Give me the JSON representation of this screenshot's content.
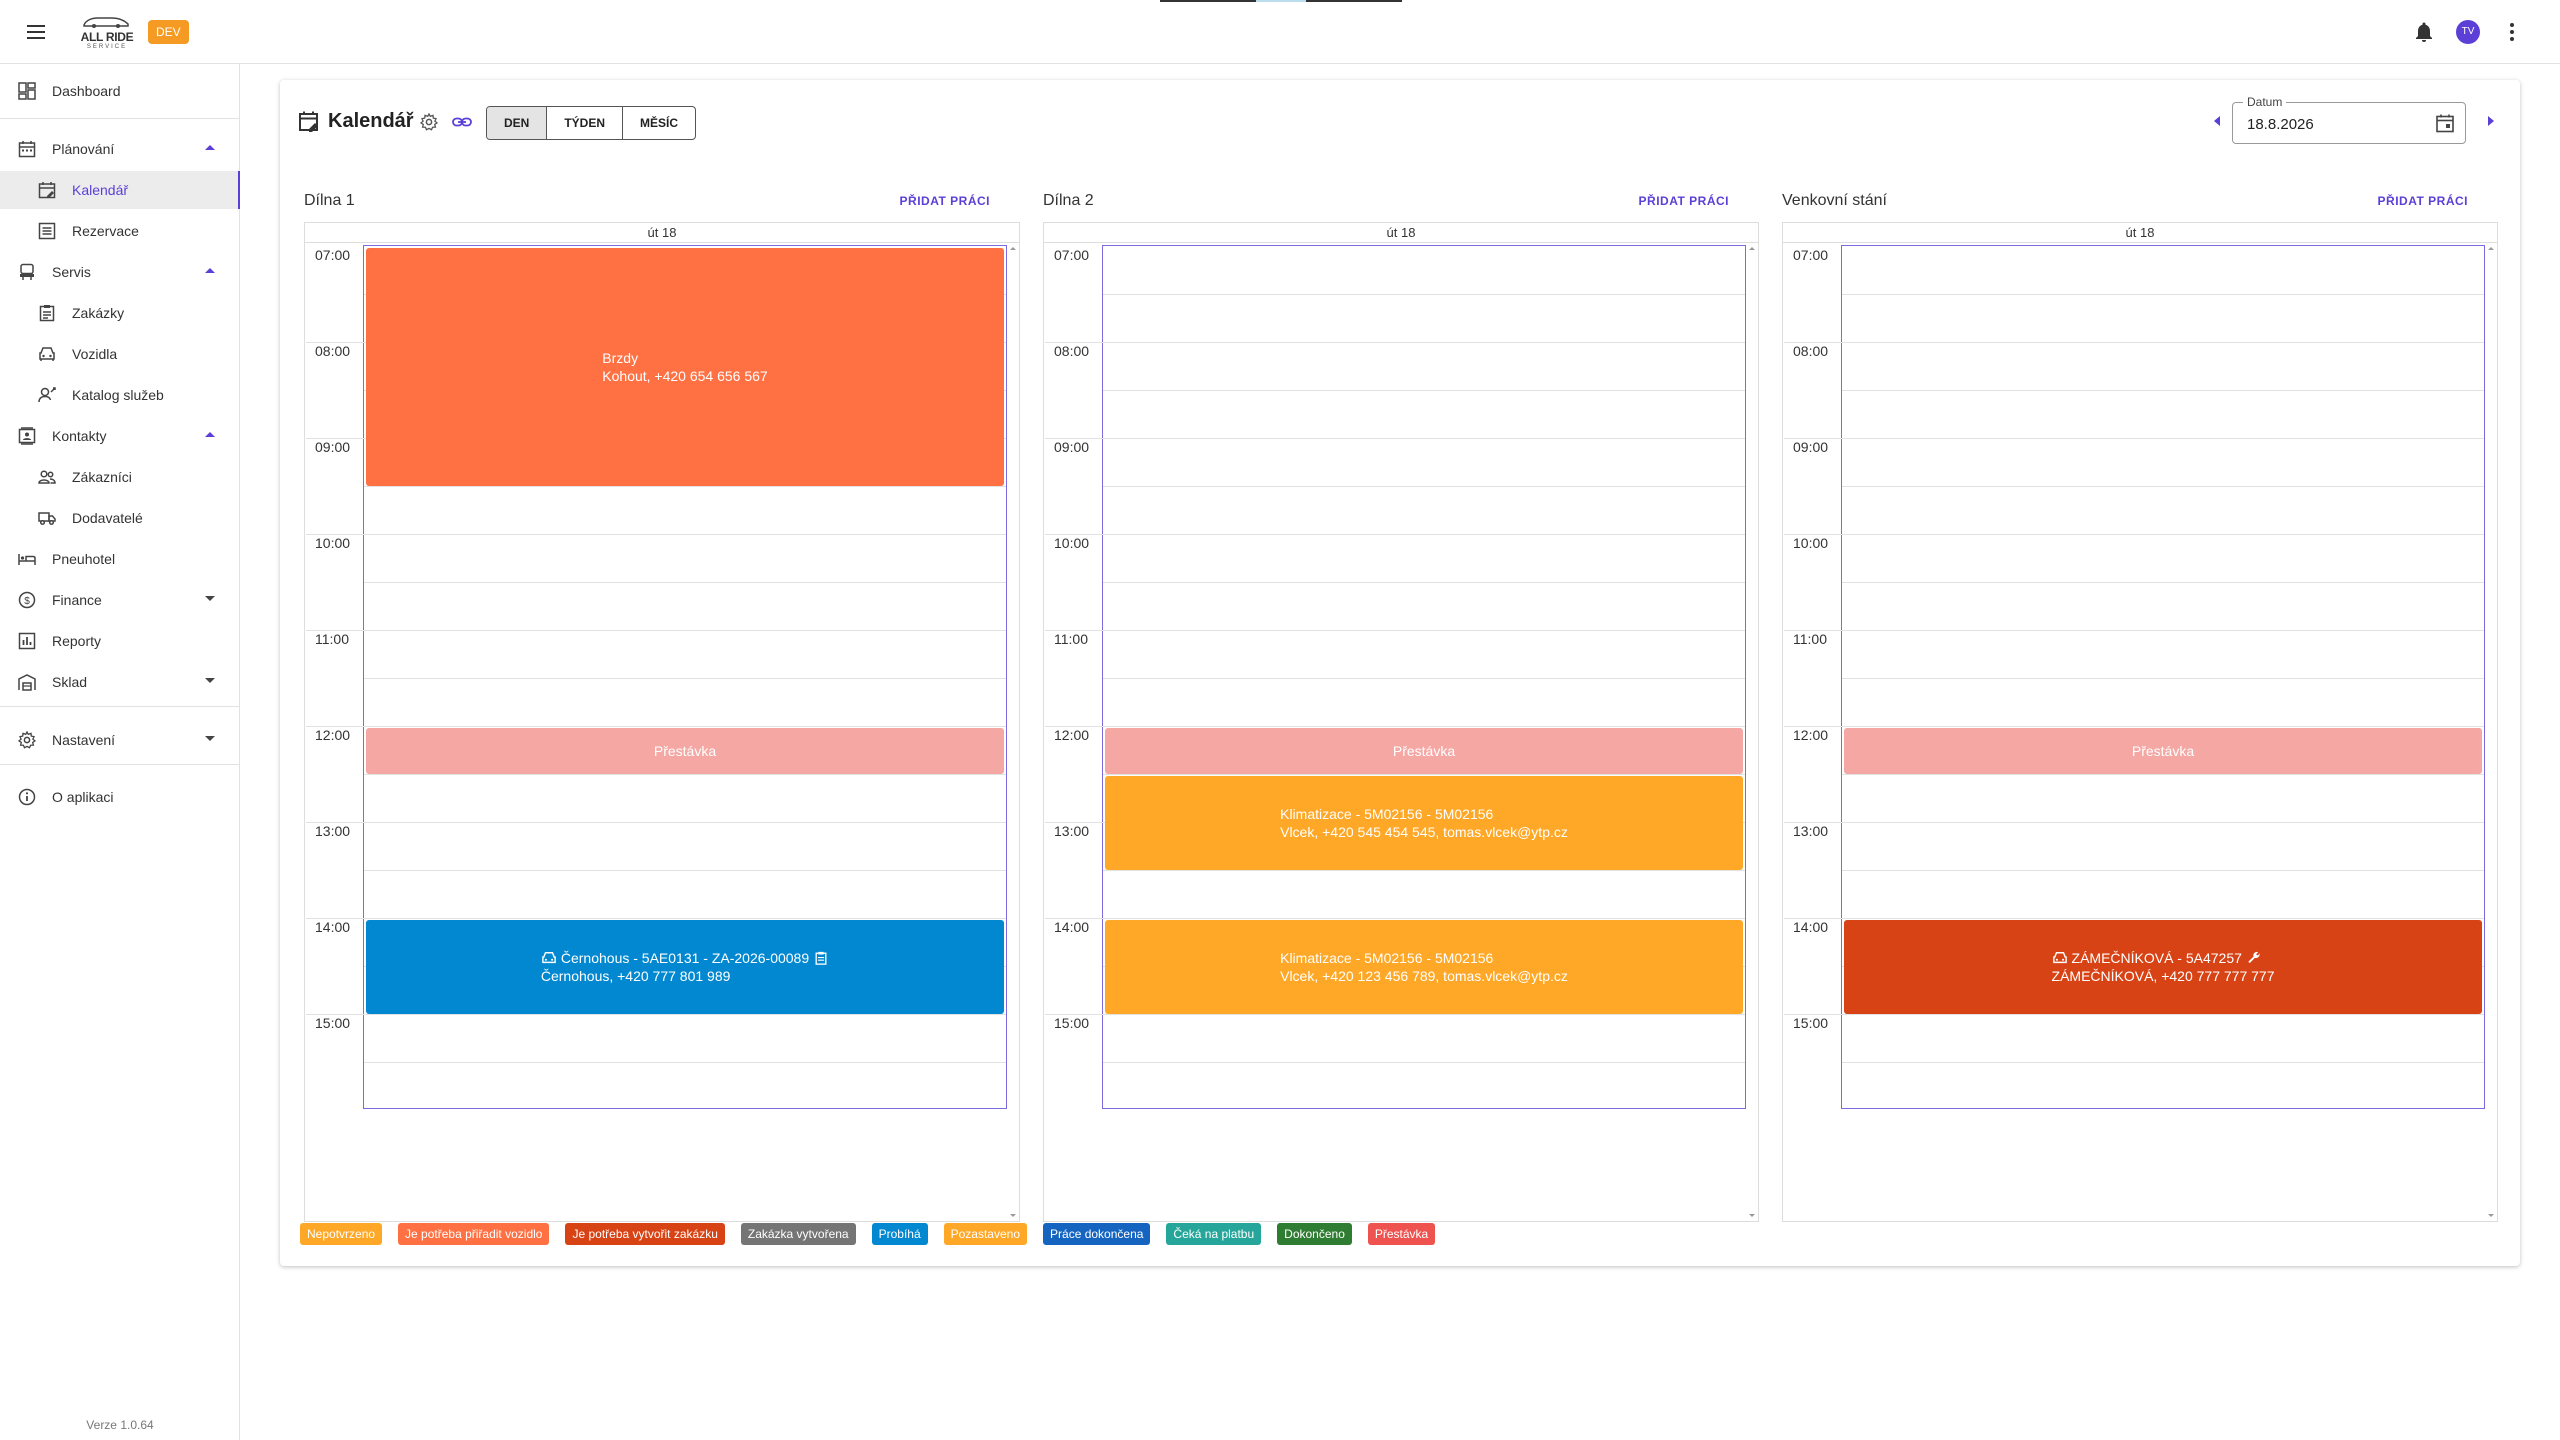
{
  "topbar": {
    "logo_text": "ALL RIDE",
    "logo_sub": "SERVICE",
    "env_badge": "DEV",
    "avatar_initials": "TV"
  },
  "sidebar": {
    "items": [
      {
        "label": "Dashboard",
        "icon": "dashboard-icon"
      },
      {
        "label": "Plánování",
        "icon": "calendar-icon"
      },
      {
        "label": "Kalendář",
        "icon": "calendar-edit-icon"
      },
      {
        "label": "Rezervace",
        "icon": "list-icon"
      },
      {
        "label": "Servis",
        "icon": "car-seat-icon"
      },
      {
        "label": "Zakázky",
        "icon": "clipboard-icon"
      },
      {
        "label": "Vozidla",
        "icon": "car-icon"
      },
      {
        "label": "Katalog služeb",
        "icon": "service-catalog-icon"
      },
      {
        "label": "Kontakty",
        "icon": "contacts-icon"
      },
      {
        "label": "Zákazníci",
        "icon": "people-icon"
      },
      {
        "label": "Dodavatelé",
        "icon": "truck-icon"
      },
      {
        "label": "Pneuhotel",
        "icon": "bed-icon"
      },
      {
        "label": "Finance",
        "icon": "dollar-icon"
      },
      {
        "label": "Reporty",
        "icon": "report-icon"
      },
      {
        "label": "Sklad",
        "icon": "warehouse-icon"
      },
      {
        "label": "Nastavení",
        "icon": "gear-icon"
      },
      {
        "label": "O aplikaci",
        "icon": "info-icon"
      }
    ],
    "version": "Verze 1.0.64"
  },
  "calendar": {
    "title": "Kalendář",
    "views": [
      "DEN",
      "TÝDEN",
      "MĚSÍC"
    ],
    "selected_view": "DEN",
    "date_label": "Datum",
    "date_value": "18.8.2026",
    "day_header": "út 18",
    "add_label": "PŘIDAT PRÁCI",
    "hours": [
      "07:00",
      "08:00",
      "09:00",
      "10:00",
      "11:00",
      "12:00",
      "13:00",
      "14:00",
      "15:00"
    ],
    "columns": [
      {
        "name": "Dílna 1",
        "events": [
          {
            "line1": "Brzdy",
            "line2": "Kohout, +420 654 656 567",
            "color": "#ff7043",
            "start": "07:00",
            "end": "09:30"
          },
          {
            "line1": "Přestávka",
            "line2": "",
            "color": "#f4a7a3",
            "start": "12:00",
            "end": "12:30"
          },
          {
            "line1": "Černohous - 5AE0131 - ZA-2026-00089",
            "line2": "Černohous, +420 777 801 989",
            "color": "#0288d1",
            "start": "14:00",
            "end": "15:00",
            "icon_before": "car-icon",
            "icon_after": "clipboard-icon"
          }
        ]
      },
      {
        "name": "Dílna 2",
        "events": [
          {
            "line1": "Přestávka",
            "line2": "",
            "color": "#f4a7a3",
            "start": "12:00",
            "end": "12:30"
          },
          {
            "line1": "Klimatizace - 5M02156 - 5M02156",
            "line2": "Vlcek, +420 545 454 545, tomas.vlcek@ytp.cz",
            "color": "#ffa726",
            "start": "12:30",
            "end": "13:30"
          },
          {
            "line1": "Klimatizace - 5M02156 - 5M02156",
            "line2": "Vlcek, +420 123 456 789, tomas.vlcek@ytp.cz",
            "color": "#ffa726",
            "start": "14:00",
            "end": "15:00"
          }
        ]
      },
      {
        "name": "Venkovní stání",
        "events": [
          {
            "line1": "Přestávka",
            "line2": "",
            "color": "#f4a7a3",
            "start": "12:00",
            "end": "12:30"
          },
          {
            "line1": "ZÁMEČNÍKOVÁ - 5A47257",
            "line2": "ZÁMEČNÍKOVÁ, +420 777 777 777",
            "color": "#d84315",
            "start": "14:00",
            "end": "15:00",
            "icon_before": "car-icon",
            "icon_after": "wrench-icon"
          }
        ]
      }
    ]
  },
  "legend": [
    {
      "label": "Nepotvrzeno",
      "color": "#ffa726"
    },
    {
      "label": "Je potřeba přiřadit vozidlo",
      "color": "#ff7043"
    },
    {
      "label": "Je potřeba vytvořit zakázku",
      "color": "#d84315"
    },
    {
      "label": "Zakázka vytvořena",
      "color": "#757575"
    },
    {
      "label": "Probíhá",
      "color": "#0288d1"
    },
    {
      "label": "Pozastaveno",
      "color": "#ffa726"
    },
    {
      "label": "Práce dokončena",
      "color": "#1565c0"
    },
    {
      "label": "Čeká na platbu",
      "color": "#26a69a"
    },
    {
      "label": "Dokončeno",
      "color": "#2e7d32"
    },
    {
      "label": "Přestávka",
      "color": "#ef5350"
    }
  ]
}
